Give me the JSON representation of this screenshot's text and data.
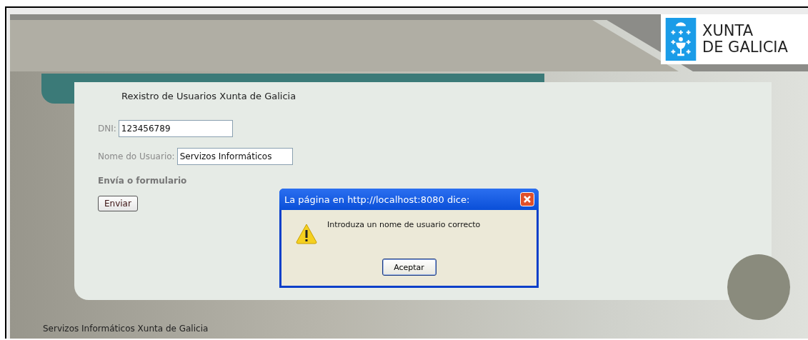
{
  "logo": {
    "line_1": "XUNTA",
    "line_2": "DE GALICIA"
  },
  "form": {
    "title": "Rexistro de Usuarios Xunta de Galicia",
    "fields": [
      {
        "label": "DNI:",
        "value": "123456789"
      },
      {
        "label": "Nome do Usuario:",
        "value": "Servizos Informáticos"
      }
    ],
    "section_label": "Envía o formulario",
    "submit_button": "Enviar"
  },
  "dialog": {
    "title": "La página en http://localhost:8080 dice:",
    "message": "Introduza un nome de usuario correcto",
    "ok_button": "Aceptar"
  },
  "footer": "Servizos Informáticos Xunta de Galicia"
}
